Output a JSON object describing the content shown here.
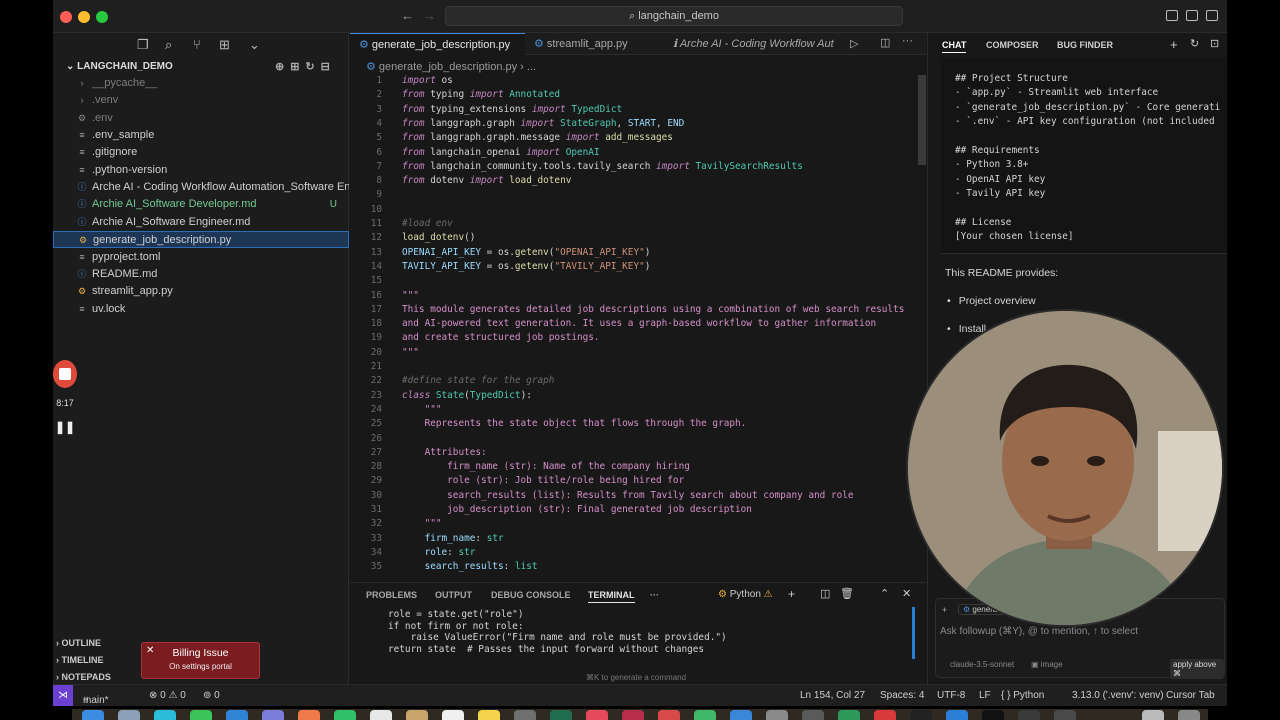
{
  "titlebar": {
    "search_text": "langchain_demo"
  },
  "sidebar": {
    "project": "LANGCHAIN_DEMO",
    "files": [
      {
        "name": "__pycache__",
        "kind": "folder",
        "dim": true
      },
      {
        "name": ".venv",
        "kind": "folder",
        "dim": true
      },
      {
        "name": ".env",
        "kind": "gear",
        "dim": true
      },
      {
        "name": ".env_sample",
        "kind": "file"
      },
      {
        "name": ".gitignore",
        "kind": "file"
      },
      {
        "name": ".python-version",
        "kind": "file"
      },
      {
        "name": "Arche AI - Coding Workflow Automation_Software Engi...",
        "kind": "md"
      },
      {
        "name": "Archie AI_Software Developer.md",
        "kind": "md",
        "badge": "U",
        "green": true
      },
      {
        "name": "Archie AI_Software Engineer.md",
        "kind": "md"
      },
      {
        "name": "generate_job_description.py",
        "kind": "py",
        "active": true
      },
      {
        "name": "pyproject.toml",
        "kind": "file"
      },
      {
        "name": "README.md",
        "kind": "md"
      },
      {
        "name": "streamlit_app.py",
        "kind": "py"
      },
      {
        "name": "uv.lock",
        "kind": "file"
      }
    ],
    "sections": [
      "OUTLINE",
      "TIMELINE",
      "NOTEPADS"
    ]
  },
  "billing": {
    "title": "Billing Issue",
    "subtitle": "On settings portal"
  },
  "recording": {
    "time": "8:17"
  },
  "editor": {
    "tabs": [
      {
        "label": "generate_job_description.py",
        "active": true
      },
      {
        "label": "streamlit_app.py"
      },
      {
        "label": "Arche AI - Coding Workflow Aut"
      }
    ],
    "breadcrumb": "generate_job_description.py  › ...",
    "line_numbers": [
      "1",
      "2",
      "3",
      "4",
      "5",
      "6",
      "7",
      "8",
      "9",
      "10",
      "11",
      "12",
      "13",
      "14",
      "15",
      "16",
      "17",
      "18",
      "19",
      "20",
      "21",
      "22",
      "23",
      "24",
      "25",
      "26",
      "27",
      "28",
      "29",
      "30",
      "31",
      "32",
      "33",
      "34",
      "35"
    ]
  },
  "panel": {
    "tabs": [
      "PROBLEMS",
      "OUTPUT",
      "DEBUG CONSOLE",
      "TERMINAL"
    ],
    "active_tab": "TERMINAL",
    "shell_label": "Python",
    "terminal_lines": [
      "role = state.get(\"role\")",
      "if not firm or not role:",
      "    raise ValueError(\"Firm name and role must be provided.\")",
      "return state  # Passes the input forward without changes"
    ],
    "hint": "⌘K to generate a command"
  },
  "chat": {
    "tabs": [
      "CHAT",
      "COMPOSER",
      "BUG FINDER"
    ],
    "markdown_lines": [
      "## Project Structure",
      "- `app.py` - Streamlit web interface",
      "- `generate_job_description.py` - Core generati",
      "- `.env` - API key configuration (not included",
      "",
      "## Requirements",
      "- Python 3.8+",
      "- OpenAI API key",
      "- Tavily API key",
      "",
      "## License",
      "[Your chosen license]"
    ],
    "intro": "This README provides:",
    "bullets": [
      "Project overview",
      "Install"
    ],
    "input_chip": "generat",
    "input_placeholder": "Ask followup (⌘Y), @ to mention, ↑ to select",
    "model": "claude-3.5-sonnet",
    "image_label": "image",
    "apply_label": "apply above ⌘"
  },
  "status": {
    "branch": "main*",
    "errors": "⊗ 0 ⚠ 0",
    "ports": "⊚ 0",
    "position": "Ln 154, Col 27",
    "spaces": "Spaces: 4",
    "encoding": "UTF-8",
    "eol": "LF",
    "language": "{ } Python",
    "interpreter": "3.13.0 ('.venv': venv)",
    "tab_mode": "Cursor Tab"
  }
}
